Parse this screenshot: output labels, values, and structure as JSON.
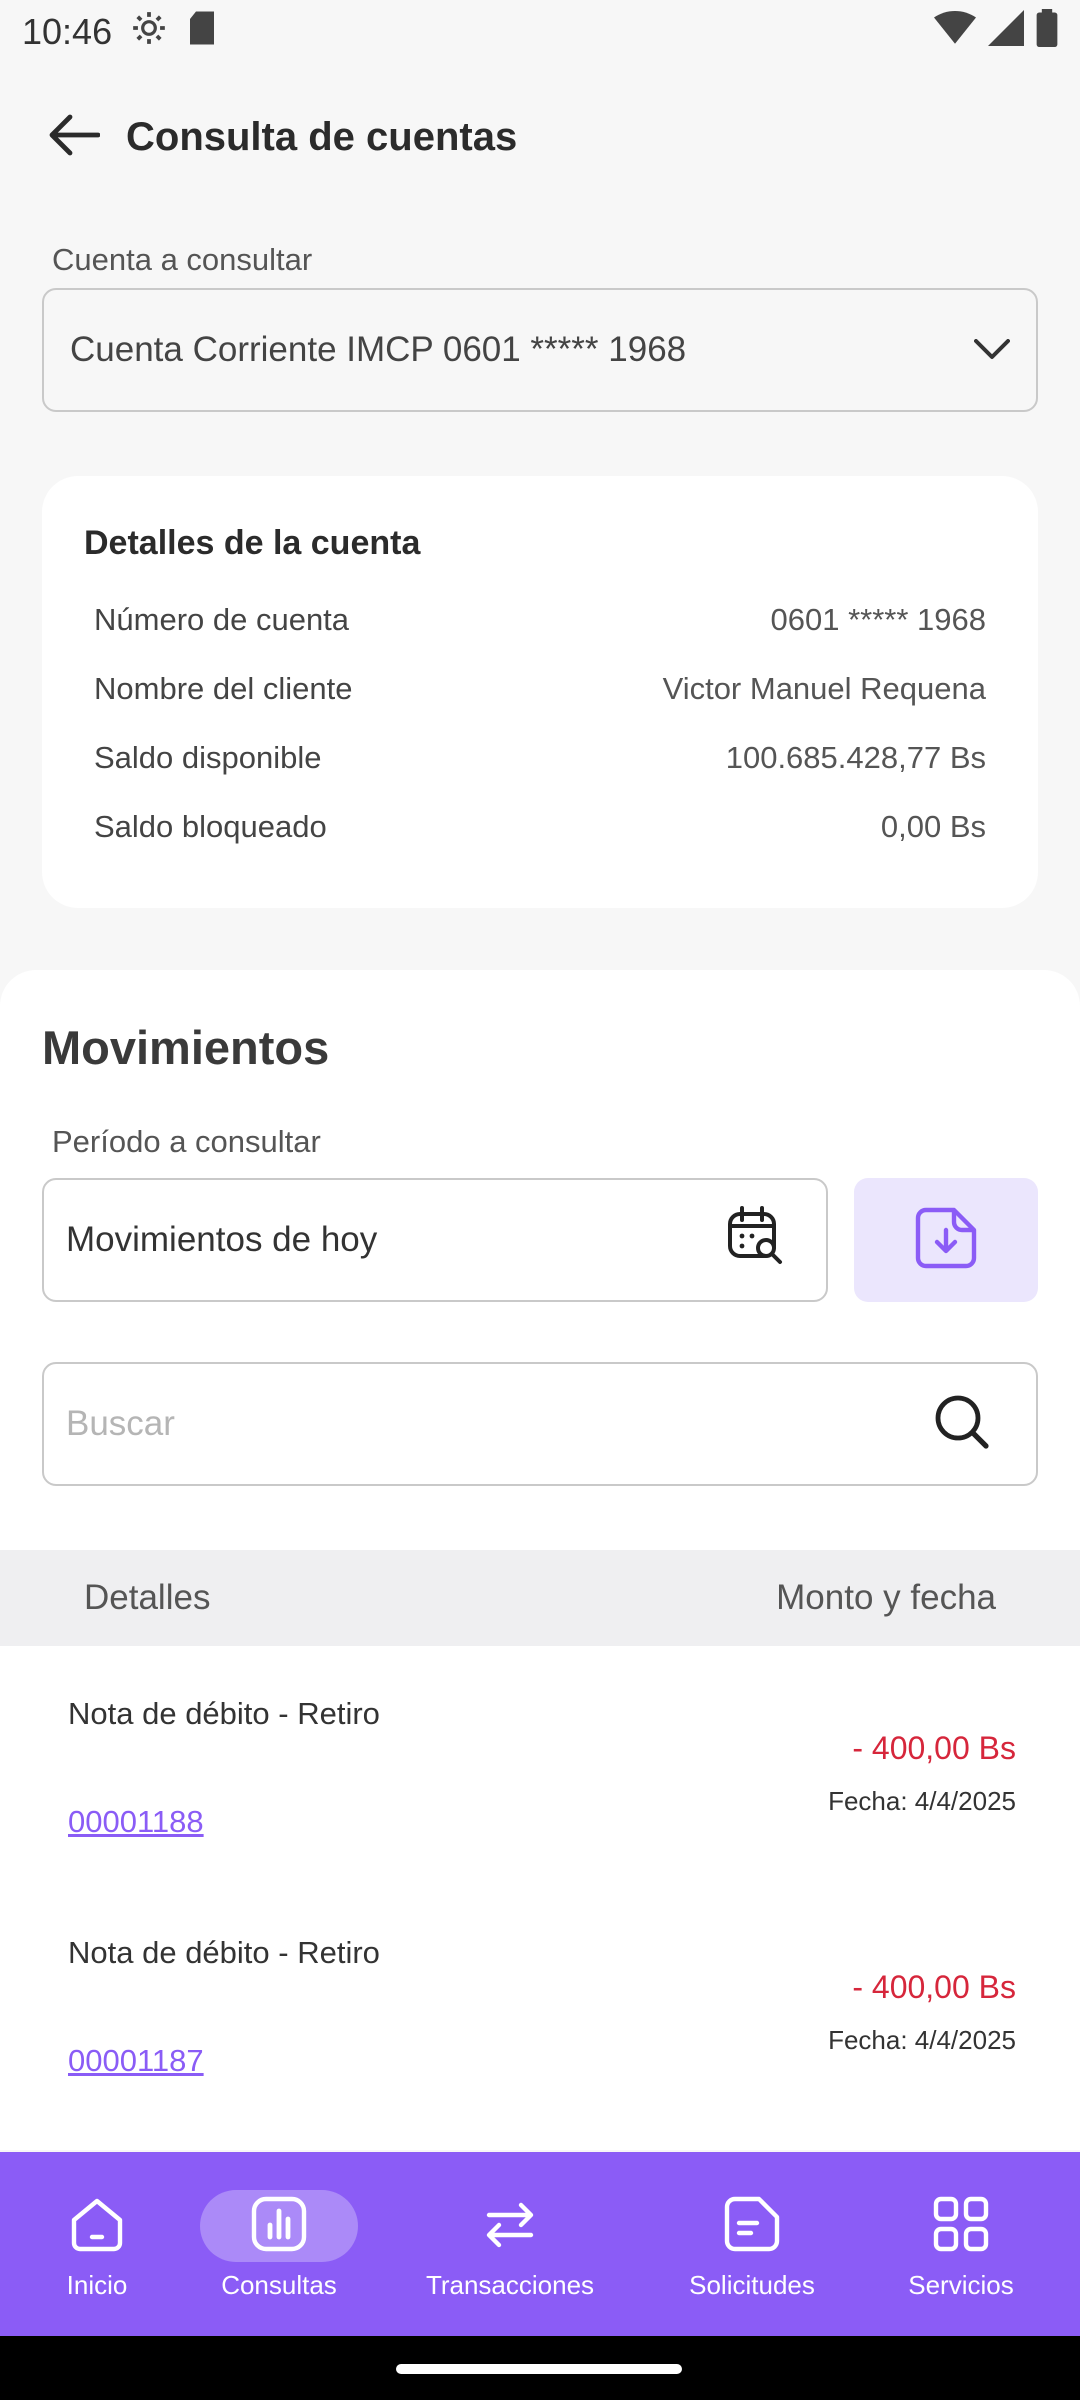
{
  "status_bar": {
    "time": "10:46"
  },
  "app_bar": {
    "title": "Consulta de cuentas"
  },
  "account_select": {
    "label": "Cuenta a consultar",
    "value": "Cuenta Corriente IMCP 0601 ***** 1968"
  },
  "details": {
    "title": "Detalles de la cuenta",
    "rows": [
      {
        "label": "Número de cuenta",
        "value": "0601 ***** 1968"
      },
      {
        "label": "Nombre del cliente",
        "value": "Victor Manuel Requena"
      },
      {
        "label": "Saldo disponible",
        "value": "100.685.428,77 Bs"
      },
      {
        "label": "Saldo bloqueado",
        "value": "0,00 Bs"
      }
    ]
  },
  "movements": {
    "title": "Movimientos",
    "period_label": "Período a consultar",
    "period_value": "Movimientos de hoy",
    "search_placeholder": "Buscar",
    "table_headers": {
      "details": "Detalles",
      "amount_date": "Monto y fecha"
    },
    "transactions": [
      {
        "description": "Nota de débito - Retiro",
        "reference": "00001188",
        "amount": "- 400,00 Bs",
        "date": "Fecha: 4/4/2025"
      },
      {
        "description": "Nota de débito - Retiro",
        "reference": "00001187",
        "amount": "- 400,00 Bs",
        "date": "Fecha: 4/4/2025"
      }
    ]
  },
  "bottom_nav": {
    "active": "Consultas",
    "items": [
      {
        "label": "Inicio",
        "icon": "home-icon"
      },
      {
        "label": "Consultas",
        "icon": "chart-icon"
      },
      {
        "label": "Transacciones",
        "icon": "transfer-arrows-icon"
      },
      {
        "label": "Solicitudes",
        "icon": "document-icon"
      },
      {
        "label": "Servicios",
        "icon": "grid-icon"
      }
    ]
  },
  "colors": {
    "accent": "#8b5cf6",
    "accent_light": "#ebe6fd",
    "debit": "#d6263b",
    "link": "#8a5cf6"
  }
}
